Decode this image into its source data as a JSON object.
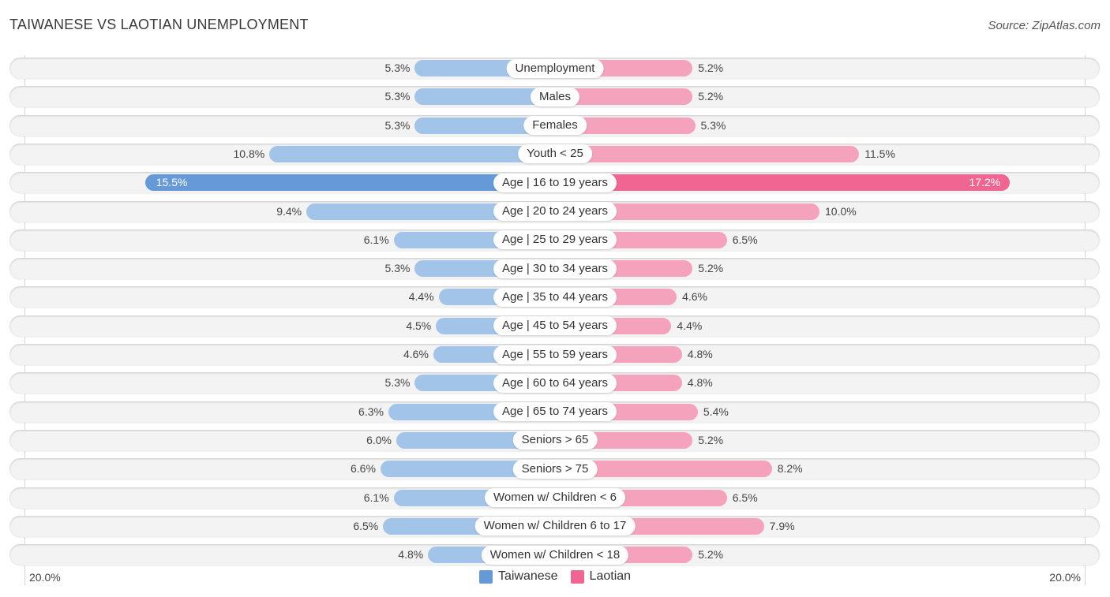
{
  "header": {
    "title": "TAIWANESE VS LAOTIAN UNEMPLOYMENT",
    "source": "Source: ZipAtlas.com"
  },
  "colors": {
    "taiwanese": "#a3c4e9",
    "taiwanese_highlight": "#6699d8",
    "laotian": "#f5a3bd",
    "laotian_highlight": "#f06592",
    "legend_taiwanese": "#6699d8",
    "legend_laotian": "#f06592"
  },
  "chart_data": {
    "type": "bar",
    "orientation": "horizontal-diverging",
    "title": "TAIWANESE VS LAOTIAN UNEMPLOYMENT",
    "xlim": [
      -20.0,
      20.0
    ],
    "axis_ticks": {
      "left": "20.0%",
      "right": "20.0%"
    },
    "legend": {
      "position": "bottom-center",
      "entries": [
        "Taiwanese",
        "Laotian"
      ]
    },
    "categories": [
      "Unemployment",
      "Males",
      "Females",
      "Youth < 25",
      "Age | 16 to 19 years",
      "Age | 20 to 24 years",
      "Age | 25 to 29 years",
      "Age | 30 to 34 years",
      "Age | 35 to 44 years",
      "Age | 45 to 54 years",
      "Age | 55 to 59 years",
      "Age | 60 to 64 years",
      "Age | 65 to 74 years",
      "Seniors > 65",
      "Seniors > 75",
      "Women w/ Children < 6",
      "Women w/ Children 6 to 17",
      "Women w/ Children < 18"
    ],
    "series": [
      {
        "name": "Taiwanese",
        "side": "left",
        "values": [
          5.3,
          5.3,
          5.3,
          10.8,
          15.5,
          9.4,
          6.1,
          5.3,
          4.4,
          4.5,
          4.6,
          5.3,
          6.3,
          6.0,
          6.6,
          6.1,
          6.5,
          4.8
        ],
        "labels": [
          "5.3%",
          "5.3%",
          "5.3%",
          "10.8%",
          "15.5%",
          "9.4%",
          "6.1%",
          "5.3%",
          "4.4%",
          "4.5%",
          "4.6%",
          "5.3%",
          "6.3%",
          "6.0%",
          "6.6%",
          "6.1%",
          "6.5%",
          "4.8%"
        ]
      },
      {
        "name": "Laotian",
        "side": "right",
        "values": [
          5.2,
          5.2,
          5.3,
          11.5,
          17.2,
          10.0,
          6.5,
          5.2,
          4.6,
          4.4,
          4.8,
          4.8,
          5.4,
          5.2,
          8.2,
          6.5,
          7.9,
          5.2
        ],
        "labels": [
          "5.2%",
          "5.2%",
          "5.3%",
          "11.5%",
          "17.2%",
          "10.0%",
          "6.5%",
          "5.2%",
          "4.6%",
          "4.4%",
          "4.8%",
          "4.8%",
          "5.4%",
          "5.2%",
          "8.2%",
          "6.5%",
          "7.9%",
          "5.2%"
        ]
      }
    ],
    "highlight_index": 4
  }
}
